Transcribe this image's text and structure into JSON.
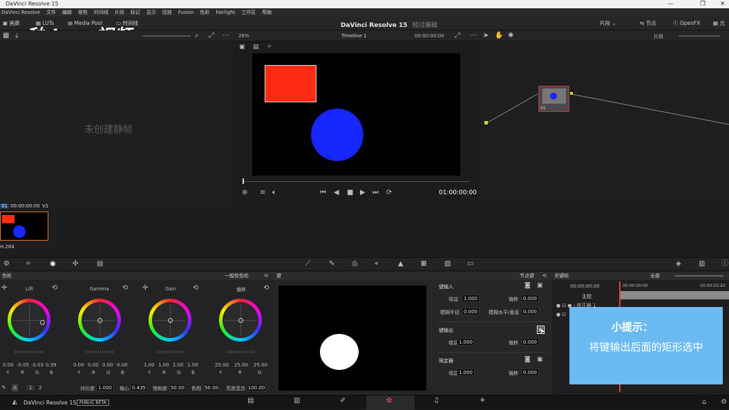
{
  "window": {
    "title": "DaVinci Resolve 15"
  },
  "menu": [
    "DaVinci Resolve",
    "文件",
    "编辑",
    "修剪",
    "时间线",
    "片段",
    "标记",
    "显示",
    "回放",
    "Fusion",
    "色彩",
    "Fairlight",
    "工作区",
    "帮助"
  ],
  "toolbar": {
    "gallery": "画廊",
    "luts": "LUTs",
    "media_pool": "Media Pool",
    "timeline": "时间线",
    "zoom": "28%",
    "timeline_name": "Timeline 1",
    "timecode": "00:00:00:00",
    "clip_label": "片段",
    "nodes_label": "节点",
    "openfx": "OpenFX",
    "clip_label2": "片段"
  },
  "app_title": {
    "name": "DaVinci Resolve 15",
    "mode": "经过编辑"
  },
  "watermark": "秒dong视频",
  "gallery": {
    "empty": "未创建静帧"
  },
  "viewer": {
    "timecode": "01:00:00:00"
  },
  "node": {
    "label": "01"
  },
  "thumb": {
    "index": "01",
    "timecode": "00:00:00:00",
    "track": "V1",
    "codec": "H.264"
  },
  "wheels": {
    "header": "色轮",
    "mode": "一般校色轮",
    "items": [
      {
        "name": "Lift",
        "values": [
          "0.00",
          "-0.05",
          "-0.03",
          "0.39"
        ]
      },
      {
        "name": "Gamma",
        "values": [
          "0.00",
          "0.00",
          "0.00",
          "0.00"
        ]
      },
      {
        "name": "Gain",
        "values": [
          "1.00",
          "1.00",
          "1.00",
          "1.00"
        ]
      },
      {
        "name": "偏移",
        "values": [
          "25.00",
          "25.00",
          "25.00",
          "25.00"
        ]
      }
    ],
    "channels": [
      "Y",
      "R",
      "G",
      "B"
    ],
    "footer": {
      "page1": "1",
      "page2": "2",
      "contrast_label": "对比度",
      "contrast": "1.000",
      "pivot_label": "轴心",
      "pivot": "0.435",
      "sat_label": "饱和度",
      "sat": "50.00",
      "hue_label": "色相",
      "hue": "50.00",
      "lummix_label": "亮度混合",
      "lummix": "100.00"
    }
  },
  "key": {
    "header": "键",
    "node_key": "节点键",
    "input_title": "键输入",
    "input_gain_label": "增益",
    "input_gain": "1.000",
    "input_offset_label": "偏移",
    "input_offset": "0.000",
    "blur_radius_label": "模糊半径",
    "blur_radius": "0.000",
    "blur_hv_label": "模糊水平/垂直",
    "blur_hv": "0.000",
    "output_title": "键输出",
    "output_gain_label": "增益",
    "output_gain": "1.000",
    "output_offset_label": "偏移",
    "output_offset": "0.000",
    "limiter_title": "限定器",
    "limiter_gain_label": "增益",
    "limiter_gain": "1.000",
    "limiter_offset_label": "偏移",
    "limiter_offset": "0.000"
  },
  "keyframes": {
    "header": "关键帧",
    "filter": "全部",
    "tc_main": "00:00:00:00",
    "tc_start": "00:00:00:00",
    "tc_end": "00:00:03:20",
    "master": "主控",
    "track": "校正器 1"
  },
  "tip": {
    "title": "小提示：",
    "body": "将键输出后面的矩形选中"
  },
  "bottom": {
    "app": "DaVinci Resolve 15",
    "badge": "PUBLIC BETA"
  }
}
